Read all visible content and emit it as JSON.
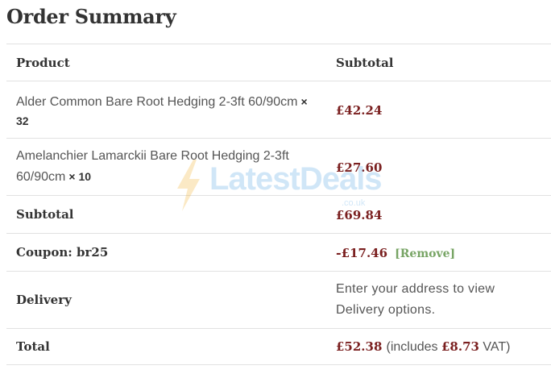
{
  "header": {
    "title": "Order Summary"
  },
  "table": {
    "col_product": "Product",
    "col_subtotal": "Subtotal",
    "items": [
      {
        "name": "Alder Common Bare Root Hedging 2-3ft 60/90cm",
        "qty": "× 32",
        "price": "£42.24"
      },
      {
        "name": "Amelanchier Lamarckii Bare Root Hedging 2-3ft 60/90cm",
        "qty": "× 10",
        "price": "£27.60"
      }
    ],
    "subtotal_label": "Subtotal",
    "subtotal_value": "£69.84",
    "coupon_label": "Coupon: br25",
    "coupon_prefix": "-",
    "coupon_value": "£17.46",
    "coupon_remove": "[Remove]",
    "delivery_label": "Delivery",
    "delivery_text": "Enter your address to view Delivery options.",
    "total_label": "Total",
    "total_value": "£52.38",
    "vat_prefix": "(includes ",
    "vat_value": "£8.73",
    "vat_suffix": " VAT)"
  },
  "watermark": {
    "text": "LatestDeals",
    "sub": ".co.uk",
    "icon": "lightning-bolt-icon"
  },
  "colors": {
    "price": "#7a1f1f",
    "remove_link": "#77a464",
    "border": "#e1e1e1",
    "watermark": "#5aa9e6"
  }
}
